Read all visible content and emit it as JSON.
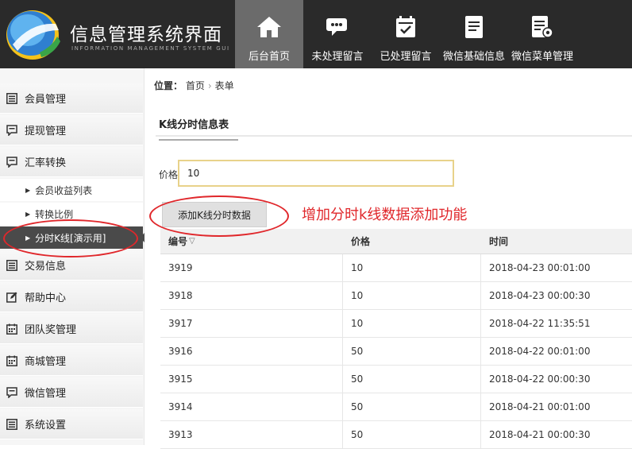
{
  "header": {
    "title": "信息管理系统界面",
    "subtitle": "INFORMATION MANAGEMENT SYSTEM GUI",
    "nav": [
      {
        "label": "后台首页",
        "icon": "home-icon",
        "active": true
      },
      {
        "label": "未处理留言",
        "icon": "chat-bubble-icon",
        "active": false
      },
      {
        "label": "已处理留言",
        "icon": "calendar-check-icon",
        "active": false
      },
      {
        "label": "微信基础信息",
        "icon": "document-icon",
        "active": false
      },
      {
        "label": "微信菜单管理",
        "icon": "document-gear-icon",
        "active": false
      }
    ]
  },
  "sidebar": {
    "items": [
      {
        "label": "会員管理",
        "icon": "list-icon"
      },
      {
        "label": "提现管理",
        "icon": "comment-icon"
      },
      {
        "label": "汇率转换",
        "icon": "comment-icon"
      },
      {
        "label": "交易信息",
        "icon": "list-icon"
      },
      {
        "label": "帮助中心",
        "icon": "edit-icon"
      },
      {
        "label": "团队奖管理",
        "icon": "calendar-icon"
      },
      {
        "label": "商城管理",
        "icon": "calendar-icon"
      },
      {
        "label": "微信管理",
        "icon": "comment-icon"
      },
      {
        "label": "系统设置",
        "icon": "list-icon"
      }
    ],
    "subitems": [
      {
        "label": "会员收益列表",
        "active": false
      },
      {
        "label": "转换比例",
        "active": false
      },
      {
        "label": "分时K线[演示用]",
        "active": true
      }
    ]
  },
  "breadcrumb": {
    "prefix": "位置：",
    "home": "首页",
    "sep": "›",
    "current": "表单"
  },
  "tab": {
    "label": "K线分时信息表"
  },
  "form": {
    "price_label": "价格",
    "price_value": "10"
  },
  "add_button": "添加K线分时数据",
  "annotation": "增加分时k线数据添加功能",
  "table": {
    "headers": [
      "编号",
      "价格",
      "时间"
    ],
    "sort_indicator": "▽",
    "rows": [
      [
        "3919",
        "10",
        "2018-04-23 00:01:00"
      ],
      [
        "3918",
        "10",
        "2018-04-23 00:00:30"
      ],
      [
        "3917",
        "10",
        "2018-04-22 11:35:51"
      ],
      [
        "3916",
        "50",
        "2018-04-22 00:01:00"
      ],
      [
        "3915",
        "50",
        "2018-04-22 00:00:30"
      ],
      [
        "3914",
        "50",
        "2018-04-21 00:01:00"
      ],
      [
        "3913",
        "50",
        "2018-04-21 00:00:30"
      ]
    ]
  },
  "colors": {
    "accent_red": "#e0272b",
    "header_bg": "#2a2a2a",
    "nav_active": "#6b6b6b",
    "sidebar_active": "#4a4a4a",
    "input_border": "#e8d28a"
  }
}
